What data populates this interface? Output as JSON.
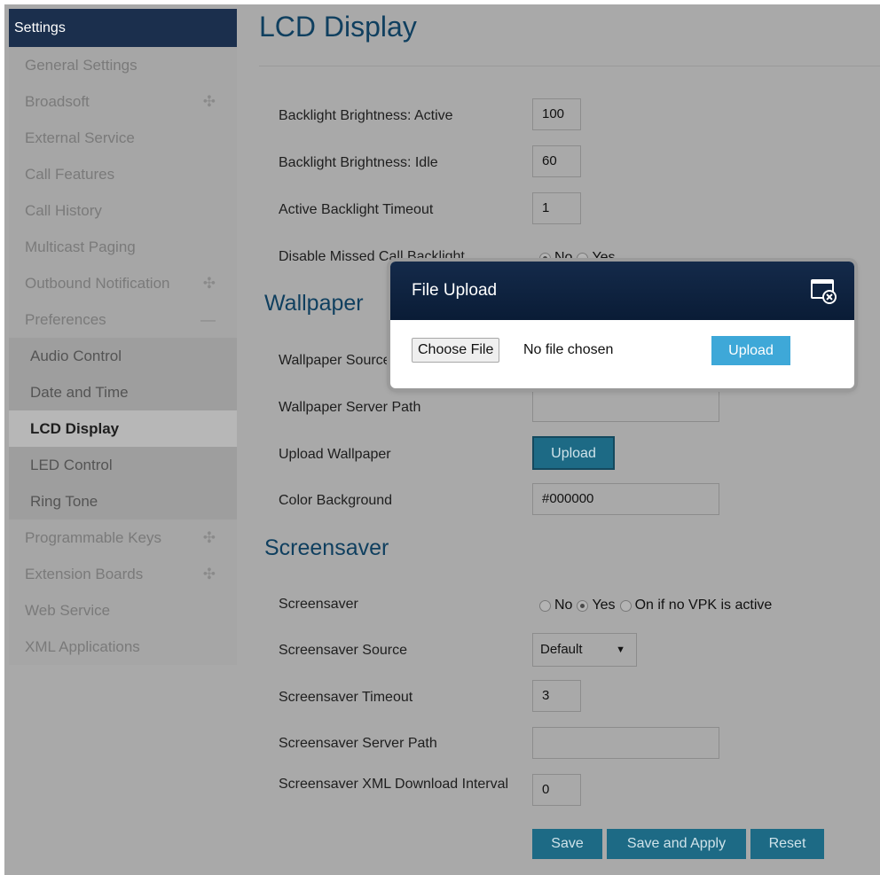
{
  "sidebar": {
    "header": "Settings",
    "items": [
      {
        "label": "General Settings",
        "expander": ""
      },
      {
        "label": "Broadsoft",
        "expander": "✣"
      },
      {
        "label": "External Service",
        "expander": ""
      },
      {
        "label": "Call Features",
        "expander": ""
      },
      {
        "label": "Call History",
        "expander": ""
      },
      {
        "label": "Multicast Paging",
        "expander": ""
      },
      {
        "label": "Outbound Notification",
        "expander": "✣"
      },
      {
        "label": "Preferences",
        "expander": "—"
      },
      {
        "label": "Audio Control",
        "expander": ""
      },
      {
        "label": "Date and Time",
        "expander": ""
      },
      {
        "label": "LCD Display",
        "expander": ""
      },
      {
        "label": "LED Control",
        "expander": ""
      },
      {
        "label": "Ring Tone",
        "expander": ""
      },
      {
        "label": "Programmable Keys",
        "expander": "✣"
      },
      {
        "label": "Extension Boards",
        "expander": "✣"
      },
      {
        "label": "Web Service",
        "expander": ""
      },
      {
        "label": "XML Applications",
        "expander": ""
      }
    ]
  },
  "page": {
    "title": "LCD Display"
  },
  "display": {
    "backlight_active_label": "Backlight Brightness: Active",
    "backlight_active_value": "100",
    "backlight_idle_label": "Backlight Brightness: Idle",
    "backlight_idle_value": "60",
    "active_timeout_label": "Active Backlight Timeout",
    "active_timeout_value": "1",
    "missed_call_label": "Disable Missed Call Backlight",
    "missed_call_no": "No",
    "missed_call_yes": "Yes"
  },
  "wallpaper": {
    "section_title": "Wallpaper",
    "source_label": "Wallpaper Source",
    "server_path_label": "Wallpaper Server Path",
    "server_path_value": "",
    "upload_label": "Upload Wallpaper",
    "upload_button": "Upload",
    "color_label": "Color Background",
    "color_value": "#000000"
  },
  "screensaver": {
    "section_title": "Screensaver",
    "mode_label": "Screensaver",
    "opt_no": "No",
    "opt_yes": "Yes",
    "opt_vpk": "On if no VPK is active",
    "source_label": "Screensaver Source",
    "source_value": "Default",
    "timeout_label": "Screensaver Timeout",
    "timeout_value": "3",
    "server_path_label": "Screensaver Server Path",
    "server_path_value": "",
    "xml_interval_label": "Screensaver XML Download Interval",
    "xml_interval_value": "0"
  },
  "actions": {
    "save": "Save",
    "save_apply": "Save and Apply",
    "reset": "Reset"
  },
  "modal": {
    "title": "File Upload",
    "choose_file": "Choose File",
    "file_status": "No file chosen",
    "upload": "Upload"
  }
}
